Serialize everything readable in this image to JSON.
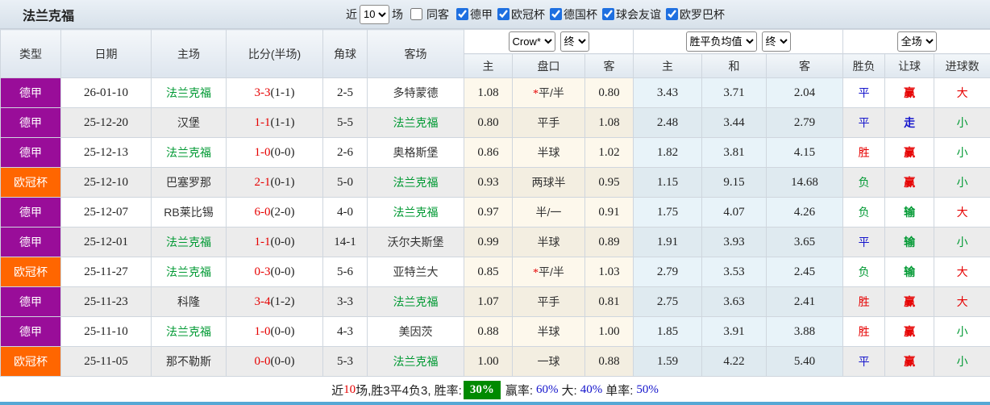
{
  "team": "法兰克福",
  "topbar": {
    "title": "法兰克福",
    "recent_label": "近",
    "recent_count": "10",
    "matches_label": "场",
    "same_away_label": "同客",
    "same_away_checked": false,
    "filters": [
      {
        "label": "德甲",
        "checked": true
      },
      {
        "label": "欧冠杯",
        "checked": true
      },
      {
        "label": "德国杯",
        "checked": true
      },
      {
        "label": "球会友谊",
        "checked": true
      },
      {
        "label": "欧罗巴杯",
        "checked": true
      }
    ]
  },
  "selects": {
    "odds_company": "Crow*",
    "odds_time": "终",
    "avg_type": "胜平负均值",
    "avg_time": "终",
    "scope": "全场"
  },
  "columns": {
    "type": "类型",
    "date": "日期",
    "home": "主场",
    "score": "比分(半场)",
    "corner": "角球",
    "away": "客场",
    "odds_home": "主",
    "handicap": "盘口",
    "odds_away": "客",
    "avg_home": "主",
    "avg_draw": "和",
    "avg_away": "客",
    "result": "胜负",
    "handicap_result": "让球",
    "goals": "进球数"
  },
  "rows": [
    {
      "league": "德甲",
      "date": "26-01-10",
      "home": "法兰克福",
      "score": "3-3",
      "half": "(1-1)",
      "corner": "2-5",
      "away": "多特蒙德",
      "odds_home": "1.08",
      "handicap": "平/半",
      "handicap_star": true,
      "odds_away": "0.80",
      "avg_home": "3.43",
      "avg_draw": "3.71",
      "avg_away": "2.04",
      "result": "平",
      "handicap_result": "赢",
      "goals_result": "大"
    },
    {
      "league": "德甲",
      "date": "25-12-20",
      "home": "汉堡",
      "score": "1-1",
      "half": "(1-1)",
      "corner": "5-5",
      "away": "法兰克福",
      "odds_home": "0.80",
      "handicap": "平手",
      "handicap_star": false,
      "odds_away": "1.08",
      "avg_home": "2.48",
      "avg_draw": "3.44",
      "avg_away": "2.79",
      "result": "平",
      "handicap_result": "走",
      "goals_result": "小"
    },
    {
      "league": "德甲",
      "date": "25-12-13",
      "home": "法兰克福",
      "score": "1-0",
      "half": "(0-0)",
      "corner": "2-6",
      "away": "奥格斯堡",
      "odds_home": "0.86",
      "handicap": "半球",
      "handicap_star": false,
      "odds_away": "1.02",
      "avg_home": "1.82",
      "avg_draw": "3.81",
      "avg_away": "4.15",
      "result": "胜",
      "handicap_result": "赢",
      "goals_result": "小"
    },
    {
      "league": "欧冠杯",
      "date": "25-12-10",
      "home": "巴塞罗那",
      "score": "2-1",
      "half": "(0-1)",
      "corner": "5-0",
      "away": "法兰克福",
      "odds_home": "0.93",
      "handicap": "两球半",
      "handicap_star": false,
      "odds_away": "0.95",
      "avg_home": "1.15",
      "avg_draw": "9.15",
      "avg_away": "14.68",
      "result": "负",
      "handicap_result": "赢",
      "goals_result": "小"
    },
    {
      "league": "德甲",
      "date": "25-12-07",
      "home": "RB莱比锡",
      "score": "6-0",
      "half": "(2-0)",
      "corner": "4-0",
      "away": "法兰克福",
      "odds_home": "0.97",
      "handicap": "半/一",
      "handicap_star": false,
      "odds_away": "0.91",
      "avg_home": "1.75",
      "avg_draw": "4.07",
      "avg_away": "4.26",
      "result": "负",
      "handicap_result": "输",
      "goals_result": "大"
    },
    {
      "league": "德甲",
      "date": "25-12-01",
      "home": "法兰克福",
      "score": "1-1",
      "half": "(0-0)",
      "corner": "14-1",
      "away": "沃尔夫斯堡",
      "odds_home": "0.99",
      "handicap": "半球",
      "handicap_star": false,
      "odds_away": "0.89",
      "avg_home": "1.91",
      "avg_draw": "3.93",
      "avg_away": "3.65",
      "result": "平",
      "handicap_result": "输",
      "goals_result": "小"
    },
    {
      "league": "欧冠杯",
      "date": "25-11-27",
      "home": "法兰克福",
      "score": "0-3",
      "half": "(0-0)",
      "corner": "5-6",
      "away": "亚特兰大",
      "odds_home": "0.85",
      "handicap": "平/半",
      "handicap_star": true,
      "odds_away": "1.03",
      "avg_home": "2.79",
      "avg_draw": "3.53",
      "avg_away": "2.45",
      "result": "负",
      "handicap_result": "输",
      "goals_result": "大"
    },
    {
      "league": "德甲",
      "date": "25-11-23",
      "home": "科隆",
      "score": "3-4",
      "half": "(1-2)",
      "corner": "3-3",
      "away": "法兰克福",
      "odds_home": "1.07",
      "handicap": "平手",
      "handicap_star": false,
      "odds_away": "0.81",
      "avg_home": "2.75",
      "avg_draw": "3.63",
      "avg_away": "2.41",
      "result": "胜",
      "handicap_result": "赢",
      "goals_result": "大"
    },
    {
      "league": "德甲",
      "date": "25-11-10",
      "home": "法兰克福",
      "score": "1-0",
      "half": "(0-0)",
      "corner": "4-3",
      "away": "美因茨",
      "odds_home": "0.88",
      "handicap": "半球",
      "handicap_star": false,
      "odds_away": "1.00",
      "avg_home": "1.85",
      "avg_draw": "3.91",
      "avg_away": "3.88",
      "result": "胜",
      "handicap_result": "赢",
      "goals_result": "小"
    },
    {
      "league": "欧冠杯",
      "date": "25-11-05",
      "home": "那不勒斯",
      "score": "0-0",
      "half": "(0-0)",
      "corner": "5-3",
      "away": "法兰克福",
      "odds_home": "1.00",
      "handicap": "一球",
      "handicap_star": false,
      "odds_away": "0.88",
      "avg_home": "1.59",
      "avg_draw": "4.22",
      "avg_away": "5.40",
      "result": "平",
      "handicap_result": "赢",
      "goals_result": "小"
    }
  ],
  "footer": {
    "prefix": "近",
    "count": "10",
    "middle": "场,胜3平4负3, 胜率:",
    "win_rate": "30%",
    "win_label": "赢率:",
    "win_value": "60%",
    "big_label": "大:",
    "big_value": "40%",
    "single_label": "单率:",
    "single_value": "50%"
  },
  "league_colors": {
    "德甲": "#990d99",
    "欧冠杯": "#ff6600"
  },
  "result_color_map": {
    "胜": "red",
    "平": "blue",
    "负": "green",
    "赢": "red",
    "走": "blue",
    "输": "green",
    "大": "red",
    "小": "green"
  },
  "colors": {
    "red": "#e60000",
    "blue": "#1414cc",
    "green": "#009933",
    "win_rate_bg": "#008a00",
    "accent_line": "#55a8d5",
    "checkbox_accent": "#1e6fe0",
    "row_even_bg": "#ececec",
    "odds_bg_odd": "#fdf8ec",
    "odds_bg_even": "#f3eee1",
    "avg_bg_odd": "#e8f3f9",
    "avg_bg_even": "#dfeaf0"
  }
}
